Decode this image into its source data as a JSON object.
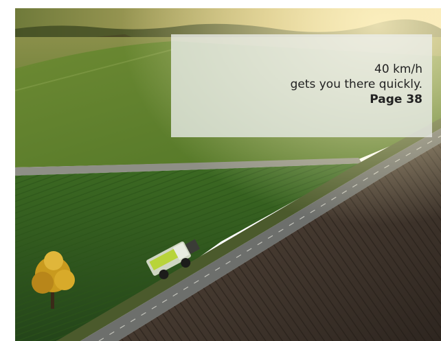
{
  "photo": {
    "subject": "aerial-field-road-tractor"
  },
  "caption": {
    "line1": "40 km/h",
    "line2": "gets you there quickly.",
    "page_ref": "Page 38"
  },
  "colors": {
    "caption_bg": "#eceeec",
    "caption_text": "#222222",
    "field_green": "#3f6a22",
    "sky_glow": "#e8d59a",
    "tractor_green": "#b8d43a"
  }
}
